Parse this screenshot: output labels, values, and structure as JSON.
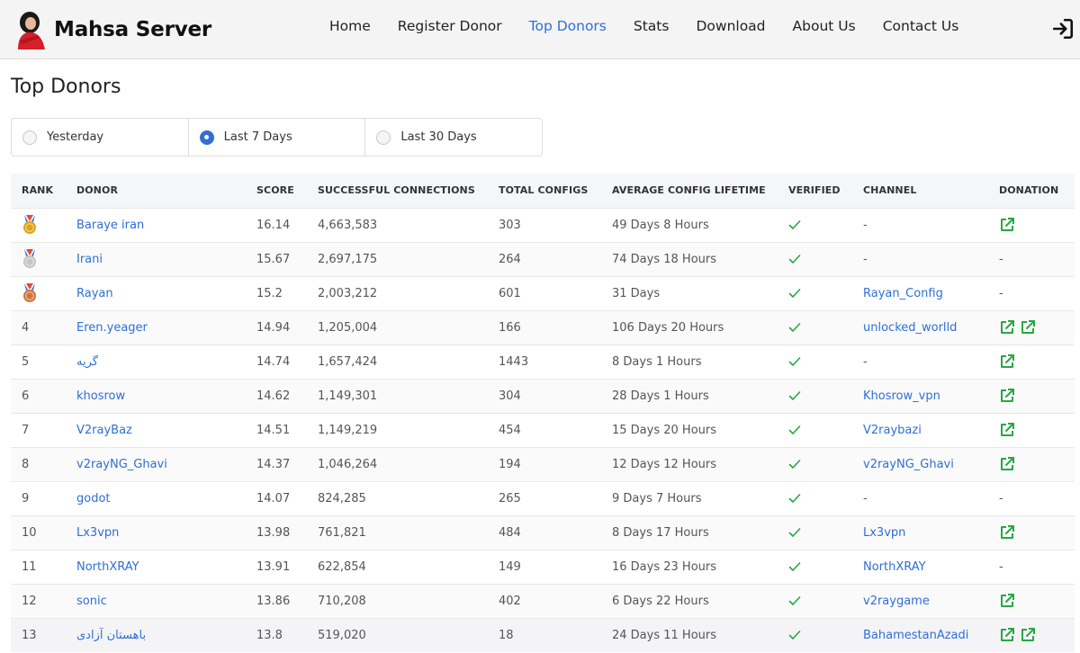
{
  "navbar": {
    "brand": "Mahsa Server",
    "links": [
      {
        "label": "Home",
        "active": false
      },
      {
        "label": "Register Donor",
        "active": false
      },
      {
        "label": "Top Donors",
        "active": true
      },
      {
        "label": "Stats",
        "active": false
      },
      {
        "label": "Download",
        "active": false
      },
      {
        "label": "About Us",
        "active": false
      },
      {
        "label": "Contact Us",
        "active": false
      }
    ],
    "login_icon": "sign-in-icon"
  },
  "page": {
    "title": "Top Donors"
  },
  "range": {
    "options": [
      {
        "label": "Yesterday",
        "checked": false
      },
      {
        "label": "Last 7 Days",
        "checked": true
      },
      {
        "label": "Last 30 Days",
        "checked": false
      }
    ]
  },
  "table": {
    "headers": [
      "RANK",
      "DONOR",
      "SCORE",
      "SUCCESSFUL CONNECTIONS",
      "TOTAL CONFIGS",
      "AVERAGE CONFIG LIFETIME",
      "VERIFIED",
      "CHANNEL",
      "DONATION"
    ],
    "rows": [
      {
        "rank": "",
        "medal": "gold",
        "donor": "Baraye iran",
        "score": "16.14",
        "connections": "4,663,583",
        "configs": "303",
        "lifetime": "49 Days 8 Hours",
        "verified": true,
        "channel": "-",
        "channel_link": false,
        "donation_links": 1,
        "donation_text": ""
      },
      {
        "rank": "",
        "medal": "silver",
        "donor": "Irani",
        "score": "15.67",
        "connections": "2,697,175",
        "configs": "264",
        "lifetime": "74 Days 18 Hours",
        "verified": true,
        "channel": "-",
        "channel_link": false,
        "donation_links": 0,
        "donation_text": "-"
      },
      {
        "rank": "",
        "medal": "bronze",
        "donor": "Rayan",
        "score": "15.2",
        "connections": "2,003,212",
        "configs": "601",
        "lifetime": "31 Days",
        "verified": true,
        "channel": "Rayan_Config",
        "channel_link": true,
        "donation_links": 0,
        "donation_text": "-"
      },
      {
        "rank": "4",
        "medal": "",
        "donor": "Eren.yeager",
        "score": "14.94",
        "connections": "1,205,004",
        "configs": "166",
        "lifetime": "106 Days 20 Hours",
        "verified": true,
        "channel": "unlocked_worlld",
        "channel_link": true,
        "donation_links": 2,
        "donation_text": ""
      },
      {
        "rank": "5",
        "medal": "",
        "donor": "گریه",
        "score": "14.74",
        "connections": "1,657,424",
        "configs": "1443",
        "lifetime": "8 Days 1 Hours",
        "verified": true,
        "channel": "-",
        "channel_link": false,
        "donation_links": 1,
        "donation_text": ""
      },
      {
        "rank": "6",
        "medal": "",
        "donor": "khosrow",
        "score": "14.62",
        "connections": "1,149,301",
        "configs": "304",
        "lifetime": "28 Days 1 Hours",
        "verified": true,
        "channel": "Khosrow_vpn",
        "channel_link": true,
        "donation_links": 1,
        "donation_text": ""
      },
      {
        "rank": "7",
        "medal": "",
        "donor": "V2rayBaz",
        "score": "14.51",
        "connections": "1,149,219",
        "configs": "454",
        "lifetime": "15 Days 20 Hours",
        "verified": true,
        "channel": "V2raybazi",
        "channel_link": true,
        "donation_links": 1,
        "donation_text": ""
      },
      {
        "rank": "8",
        "medal": "",
        "donor": "v2rayNG_Ghavi",
        "score": "14.37",
        "connections": "1,046,264",
        "configs": "194",
        "lifetime": "12 Days 12 Hours",
        "verified": true,
        "channel": "v2rayNG_Ghavi",
        "channel_link": true,
        "donation_links": 1,
        "donation_text": ""
      },
      {
        "rank": "9",
        "medal": "",
        "donor": "godot",
        "score": "14.07",
        "connections": "824,285",
        "configs": "265",
        "lifetime": "9 Days 7 Hours",
        "verified": true,
        "channel": "-",
        "channel_link": false,
        "donation_links": 0,
        "donation_text": "-"
      },
      {
        "rank": "10",
        "medal": "",
        "donor": "Lx3vpn",
        "score": "13.98",
        "connections": "761,821",
        "configs": "484",
        "lifetime": "8 Days 17 Hours",
        "verified": true,
        "channel": "Lx3vpn",
        "channel_link": true,
        "donation_links": 1,
        "donation_text": ""
      },
      {
        "rank": "11",
        "medal": "",
        "donor": "NorthXRAY",
        "score": "13.91",
        "connections": "622,854",
        "configs": "149",
        "lifetime": "16 Days 23 Hours",
        "verified": true,
        "channel": "NorthXRAY",
        "channel_link": true,
        "donation_links": 0,
        "donation_text": "-"
      },
      {
        "rank": "12",
        "medal": "",
        "donor": "sonic",
        "score": "13.86",
        "connections": "710,208",
        "configs": "402",
        "lifetime": "6 Days 22 Hours",
        "verified": true,
        "channel": "v2raygame",
        "channel_link": true,
        "donation_links": 1,
        "donation_text": ""
      },
      {
        "rank": "13",
        "medal": "",
        "donor": "باهستان آزادی",
        "score": "13.8",
        "connections": "519,020",
        "configs": "18",
        "lifetime": "24 Days 11 Hours",
        "verified": true,
        "channel": "BahamestanAzadi",
        "channel_link": true,
        "donation_links": 2,
        "donation_text": ""
      }
    ]
  },
  "colors": {
    "accent": "#2f6fd6",
    "success": "#28a745",
    "gold": "#e0a21a",
    "silver": "#c4c4c4",
    "bronze": "#d0763a"
  }
}
